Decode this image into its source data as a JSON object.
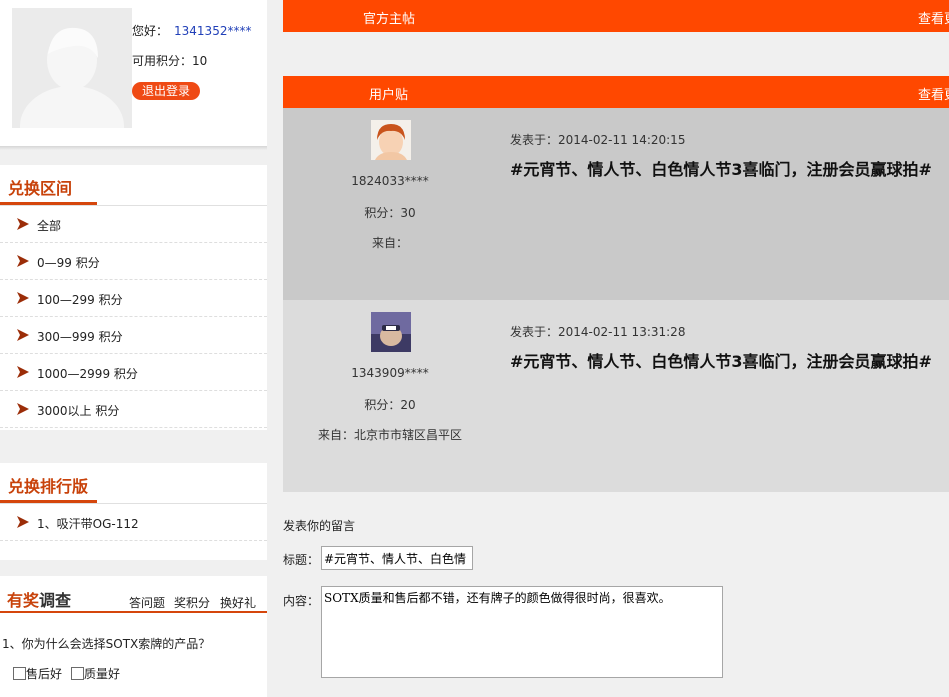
{
  "user": {
    "greeting": "您好：",
    "user_id": "1341352****",
    "points_text": "可用积分：10",
    "logout_label": "退出登录"
  },
  "exchange": {
    "title": "兑换区间",
    "items": [
      "全部",
      "0—99 积分",
      "100—299 积分",
      "300—999 积分",
      "1000—2999 积分",
      "3000以上 积分"
    ]
  },
  "ranking": {
    "title": "兑换排行版",
    "items": [
      "1、吸汗带OG-112"
    ]
  },
  "survey": {
    "title_accent": "有奖",
    "title_rest": "调查",
    "links": [
      "答问题",
      "奖积分",
      "换好礼"
    ],
    "question": "1、你为什么会选择SOTX索牌的产品？",
    "options": [
      "售后好",
      "质量好"
    ]
  },
  "official_bar": {
    "title": "官方主帖",
    "more": "查看更"
  },
  "user_bar": {
    "title": "用户贴",
    "more": "查看更"
  },
  "posts": [
    {
      "user": "1824033****",
      "points": "积分：30",
      "from": "来自：",
      "date": "发表于：2014-02-11 14:20:15",
      "title": "#元宵节、情人节、白色情人节3喜临门，注册会员赢球拍#"
    },
    {
      "user": "1343909****",
      "points": "积分：20",
      "from": "来自：北京市市辖区昌平区",
      "date": "发表于：2014-02-11 13:31:28",
      "title": "#元宵节、情人节、白色情人节3喜临门，注册会员赢球拍#"
    }
  ],
  "compose": {
    "heading": "发表你的留言",
    "title_label": "标题：",
    "title_value": "#元宵节、情人节、白色情",
    "content_label": "内容：",
    "content_value": "SOTX质量和售后都不错，还有牌子的颜色做得很时尚，很喜欢。"
  },
  "colors": {
    "accent": "#ff4800",
    "heading": "#c8420a",
    "link": "#2140b8"
  }
}
